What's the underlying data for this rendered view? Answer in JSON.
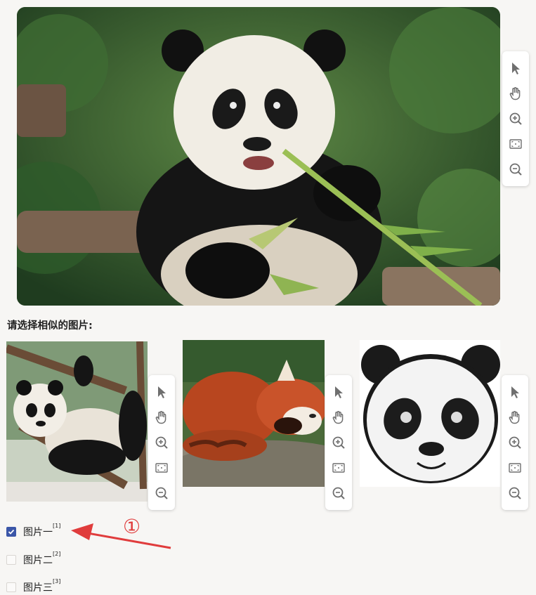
{
  "prompt": "请选择相似的图片:",
  "main_image": {
    "alt": "panda-eating-bamboo"
  },
  "toolbar_icons": [
    "pointer-icon",
    "hand-icon",
    "zoom-in-icon",
    "fit-screen-icon",
    "zoom-out-icon"
  ],
  "thumbnails": [
    {
      "subject": "panda-hanging-on-branch"
    },
    {
      "subject": "red-panda-sleeping"
    },
    {
      "subject": "panda-face-illustration"
    }
  ],
  "options": [
    {
      "label": "图片一",
      "ref": "[1]",
      "checked": true
    },
    {
      "label": "图片二",
      "ref": "[2]",
      "checked": false
    },
    {
      "label": "图片三",
      "ref": "[3]",
      "checked": false
    }
  ],
  "annotation": {
    "marker": "①",
    "color": "#e03c3c"
  },
  "colors": {
    "checkbox_checked": "#3b56a8",
    "background": "#f7f6f4"
  }
}
